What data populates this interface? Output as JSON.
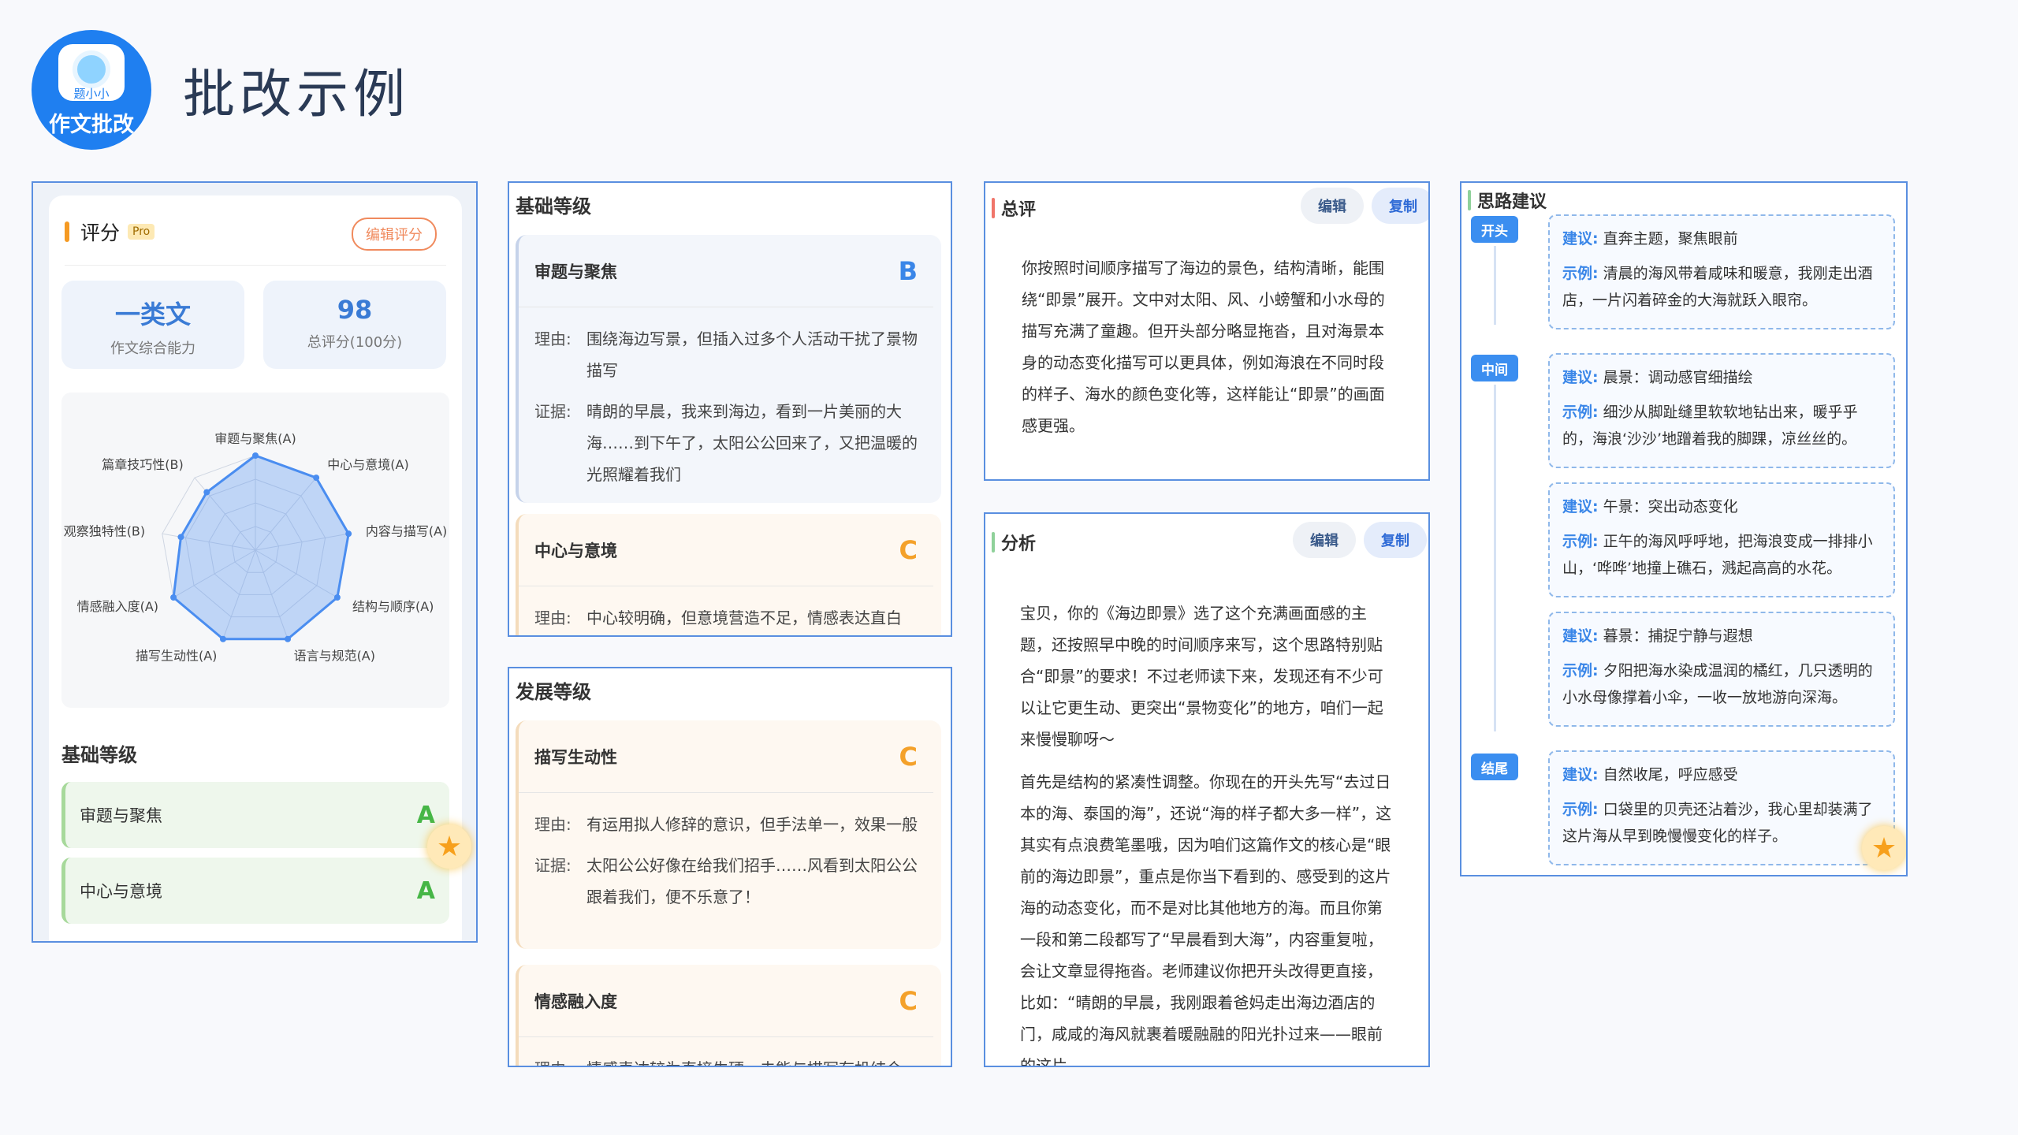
{
  "logo": {
    "brand": "题小小",
    "tag": "作文批改"
  },
  "title": "批改示例",
  "score_panel": {
    "title": "评分",
    "pro": "Pro",
    "edit": "编辑评分",
    "stat1": {
      "value": "一类文",
      "label": "作文综合能力"
    },
    "stat2": {
      "value": "98",
      "label": "总评分(100分)"
    },
    "radar_labels": [
      "审题与聚焦(A)",
      "中心与意境(A)",
      "内容与描写(A)",
      "结构与顺序(A)",
      "语言与规范(A)",
      "描写生动性(A)",
      "情感融入度(A)",
      "观察独特性(B)",
      "篇章技巧性(B)"
    ],
    "radar_values": [
      1,
      1,
      1,
      1,
      1,
      1,
      1,
      0.8,
      0.8
    ],
    "basic_title": "基础等级",
    "rows": [
      {
        "name": "审题与聚焦",
        "grade": "A"
      },
      {
        "name": "中心与意境",
        "grade": "A"
      }
    ]
  },
  "basic_panel": {
    "title": "基础等级",
    "items": [
      {
        "name": "审题与聚焦",
        "grade": "B",
        "reason_k": "理由:",
        "reason": "围绕海边写景，但插入过多个人活动干扰了景物描写",
        "evidence_k": "证据:",
        "evidence": "晴朗的早晨，我来到海边，看到一片美丽的大海……到下午了，太阳公公回来了，又把温暖的光照耀着我们"
      },
      {
        "name": "中心与意境",
        "grade": "C",
        "reason_k": "理由:",
        "reason": "中心较明确，但意境营造不足，情感表达直白"
      }
    ]
  },
  "dev_panel": {
    "title": "发展等级",
    "items": [
      {
        "name": "描写生动性",
        "grade": "C",
        "reason_k": "理由:",
        "reason": "有运用拟人修辞的意识，但手法单一，效果一般",
        "evidence_k": "证据:",
        "evidence": "太阳公公好像在给我们招手……风看到太阳公公跟着我们，便不乐意了！"
      },
      {
        "name": "情感融入度",
        "grade": "C",
        "reason_k": "理由:",
        "reason": "情感表达较为直接生硬，未能与描写有机结合"
      }
    ]
  },
  "summary_panel": {
    "title": "总评",
    "edit": "编辑",
    "copy": "复制",
    "text": "你按照时间顺序描写了海边的景色，结构清晰，能围绕“即景”展开。文中对太阳、风、小螃蟹和小水母的描写充满了童趣。但开头部分略显拖沓，且对海景本身的动态变化描写可以更具体，例如海浪在不同时段的样子、海水的颜色变化等，这样能让“即景”的画面感更强。"
  },
  "analysis_panel": {
    "title": "分析",
    "edit": "编辑",
    "copy": "复制",
    "p1": "宝贝，你的《海边即景》选了这个充满画面感的主题，还按照早中晚的时间顺序来写，这个思路特别贴合“即景”的要求！不过老师读下来，发现还有不少可以让它更生动、更突出“景物变化”的地方，咱们一起来慢慢聊呀～",
    "p2": "首先是结构的紧凑性调整。你现在的开头先写“去过日本的海、泰国的海”，还说“海的样子都大多一样”，这其实有点浪费笔墨哦，因为咱们这篇作文的核心是“眼前的海边即景”，重点是你当下看到的、感受到的这片海的动态变化，而不是对比其他地方的海。而且你第一段和第二段都写了“早晨看到大海”，内容重复啦，会让文章显得拖沓。老师建议你把开头改得更直接，比如：“晴朗的早晨，我刚跟着爸妈走出海边酒店的门，咸咸的海风就裹着暖融融的阳光扑过来——眼前的这片"
  },
  "idea_panel": {
    "title": "思路建议",
    "k_sug": "建议:",
    "k_ex": "示例:",
    "tags": [
      "开头",
      "中间",
      "结尾"
    ],
    "items": [
      {
        "sug": "直奔主题，聚焦眼前",
        "ex": "清晨的海风带着咸味和暖意，我刚走出酒店，一片闪着碎金的大海就跃入眼帘。"
      },
      {
        "sug": "晨景：调动感官细描绘",
        "ex": "细沙从脚趾缝里软软地钻出来，暖乎乎的，海浪‘沙沙’地蹭着我的脚踝，凉丝丝的。"
      },
      {
        "sug": "午景：突出动态变化",
        "ex": "正午的海风呼呼地，把海浪变成一排排小山，‘哗哗’地撞上礁石，溅起高高的水花。"
      },
      {
        "sug": "暮景：捕捉宁静与遐想",
        "ex": "夕阳把海水染成温润的橘红，几只透明的小水母像撑着小伞，一收一放地游向深海。"
      },
      {
        "sug": "自然收尾，呼应感受",
        "ex": "口袋里的贝壳还沾着沙，我心里却装满了这片海从早到晚慢慢变化的样子。"
      }
    ]
  },
  "colors": {
    "accent": "#3a86e8",
    "panel_border": "#5a8fe0",
    "grade_a": "#46b646",
    "grade_c": "#f4a12a"
  }
}
